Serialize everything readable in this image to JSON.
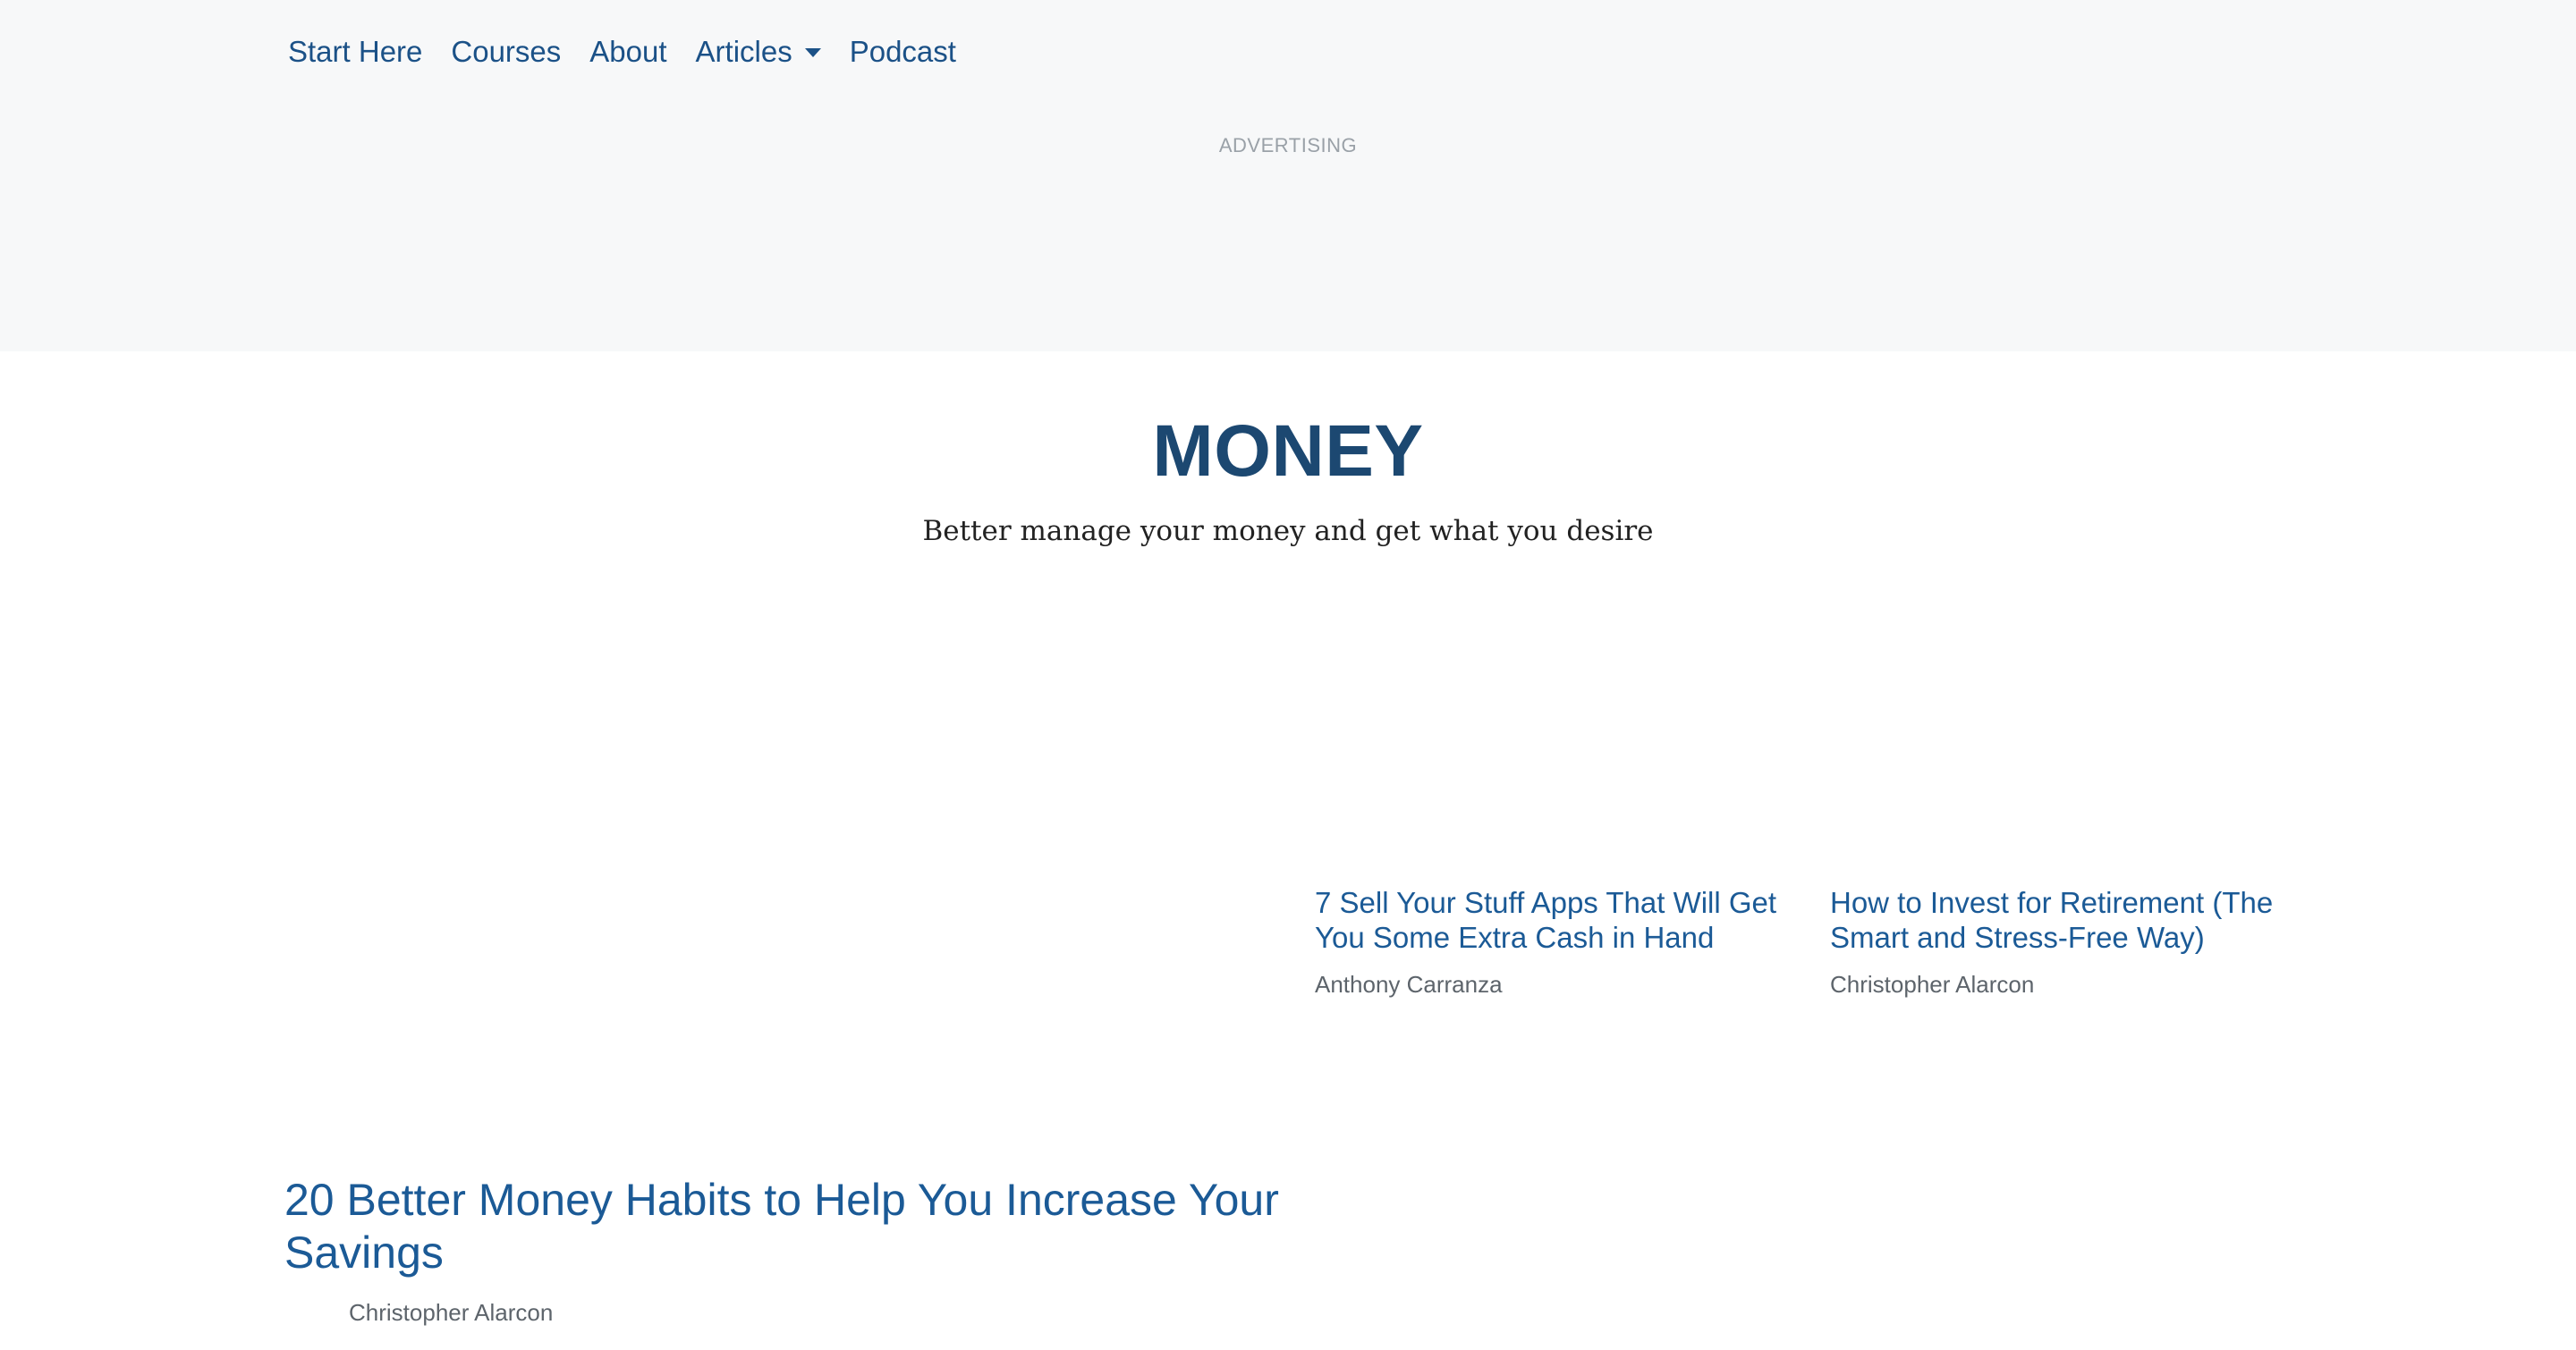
{
  "nav": {
    "items": [
      {
        "label": "Start Here"
      },
      {
        "label": "Courses"
      },
      {
        "label": "About"
      },
      {
        "label": "Articles"
      },
      {
        "label": "Podcast"
      }
    ]
  },
  "ad": {
    "label": "ADVERTISING"
  },
  "hero": {
    "title": "MONEY",
    "subtitle": "Better manage your money and get what you desire"
  },
  "articles": [
    {
      "title": "7 Sell Your Stuff Apps That Will Get You Some Extra Cash in Hand",
      "author": "Anthony Carranza"
    },
    {
      "title": "How to Invest for Retirement (The Smart and Stress-Free Way)",
      "author": "Christopher Alarcon"
    },
    {
      "title": "20 Better Money Habits to Help You Increase Your Savings",
      "author": "Christopher Alarcon"
    }
  ],
  "colors": {
    "link": "#1b5187",
    "heading": "#1c4871",
    "band": "#f7f8f9"
  }
}
